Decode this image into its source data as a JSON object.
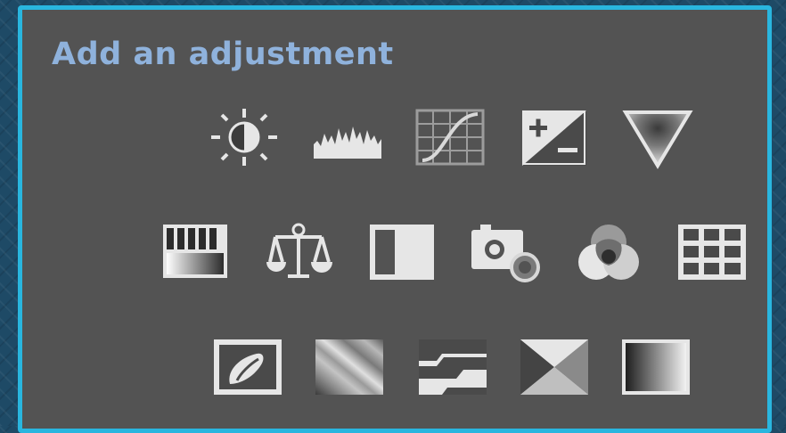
{
  "panel": {
    "title": "Add an adjustment"
  },
  "rows": [
    {
      "icons": [
        "brightness-contrast-icon",
        "levels-icon",
        "curves-icon",
        "exposure-icon",
        "vibrance-icon"
      ]
    },
    {
      "icons": [
        "hue-saturation-icon",
        "color-balance-icon",
        "black-and-white-icon",
        "photo-filter-icon",
        "channel-mixer-icon",
        "color-lookup-icon"
      ]
    },
    {
      "icons": [
        "invert-icon",
        "posterize-icon",
        "threshold-icon",
        "selective-color-icon",
        "gradient-map-icon"
      ]
    }
  ],
  "colors": {
    "panel_background": "#535353",
    "panel_border": "#29b6df",
    "title_text": "#8fb2dc",
    "icon_light": "#e6e6e6"
  }
}
